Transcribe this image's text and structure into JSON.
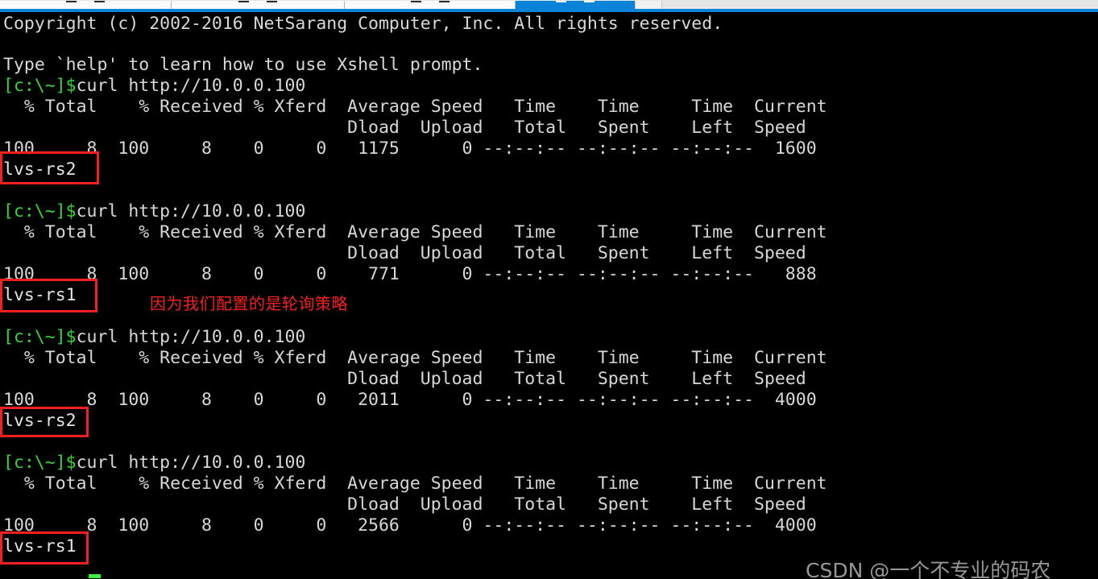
{
  "window": {
    "tabbar": {
      "accent_color": "#0a84d8",
      "tabs": [
        {
          "label": "",
          "active": false
        },
        {
          "label": "",
          "active": false
        },
        {
          "label": "",
          "active": false
        },
        {
          "label": "",
          "active": true
        }
      ]
    }
  },
  "terminal": {
    "background_color": "#000000",
    "text_color": "#d8d8d8",
    "prompt_color": "#33d633",
    "prompt": "[c:\\~]$",
    "banner": [
      "Copyright (c) 2002-2016 NetSarang Computer, Inc. All rights reserved.",
      "",
      "Type `help' to learn how to use Xshell prompt."
    ],
    "command": "curl http://10.0.0.100",
    "curl_header_line1": "  % Total    % Received % Xferd  Average Speed   Time    Time     Time  Current",
    "curl_header_line2": "                                 Dload  Upload   Total   Spent    Left  Speed",
    "blocks": [
      {
        "stats": "100     8  100     8    0     0   1175      0 --:--:-- --:--:-- --:--:--  1600",
        "response": "lvs-rs2"
      },
      {
        "stats": "100     8  100     8    0     0    771      0 --:--:-- --:--:-- --:--:--   888",
        "response": "lvs-rs1"
      },
      {
        "stats": "100     8  100     8    0     0   2011      0 --:--:-- --:--:-- --:--:--  4000",
        "response": "lvs-rs2"
      },
      {
        "stats": "100     8  100     8    0     0   2566      0 --:--:-- --:--:-- --:--:--  4000",
        "response": "lvs-rs1"
      }
    ]
  },
  "annotations": {
    "box_color": "#f51f1f",
    "note": "因为我们配置的是轮询策略",
    "note_color": "#f51f1f"
  },
  "watermark": {
    "text": "CSDN @一个不专业的码农",
    "color": "#b9b9b9"
  }
}
